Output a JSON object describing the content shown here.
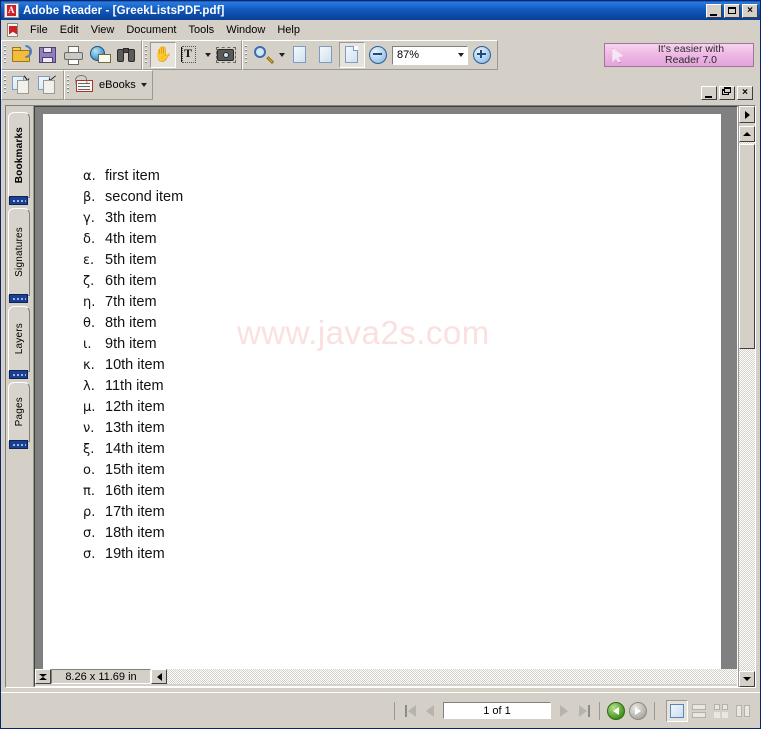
{
  "window": {
    "app_title": "Adobe Reader - [GreekListsPDF.pdf]",
    "app_icon": "adobe-reader-icon",
    "controls": {
      "minimize": "_",
      "maximize": "□",
      "restore": "❐",
      "close": "×"
    }
  },
  "menubar": {
    "doc_icon": "pdf-document-icon",
    "items": [
      {
        "label": "File"
      },
      {
        "label": "Edit"
      },
      {
        "label": "View"
      },
      {
        "label": "Document"
      },
      {
        "label": "Tools"
      },
      {
        "label": "Window"
      },
      {
        "label": "Help"
      }
    ]
  },
  "toolbar": {
    "file_group": [
      {
        "name": "open-button",
        "icon": "open-folder-icon",
        "tooltip": "Open"
      },
      {
        "name": "save-button",
        "icon": "floppy-disk-icon",
        "tooltip": "Save a Copy"
      },
      {
        "name": "print-button",
        "icon": "printer-icon",
        "tooltip": "Print"
      },
      {
        "name": "email-button",
        "icon": "email-globe-icon",
        "tooltip": "Email"
      },
      {
        "name": "search-button",
        "icon": "binoculars-icon",
        "tooltip": "Search"
      }
    ],
    "tools_group": [
      {
        "name": "hand-tool-button",
        "icon": "hand-icon",
        "pressed": true
      },
      {
        "name": "select-text-button",
        "icon": "text-select-icon",
        "pressed": false,
        "has_dropdown": true
      },
      {
        "name": "snapshot-button",
        "icon": "camera-icon",
        "pressed": false
      }
    ],
    "zoom_group": {
      "zoom_tool": {
        "name": "zoom-in-tool-button",
        "icon": "magnifier-plus-icon",
        "has_dropdown": true
      },
      "page_fit_buttons": [
        {
          "name": "actual-size-button",
          "icon": "page-actual-size-icon",
          "pressed": false
        },
        {
          "name": "fit-page-button",
          "icon": "page-fit-page-icon",
          "pressed": false
        },
        {
          "name": "fit-width-button",
          "icon": "page-fit-width-icon",
          "pressed": true
        }
      ],
      "zoom_out": {
        "name": "zoom-out-button",
        "icon": "circle-minus-icon"
      },
      "zoom_value": "87%",
      "zoom_in": {
        "name": "zoom-in-button",
        "icon": "circle-plus-icon"
      }
    },
    "second_row": {
      "history": [
        {
          "name": "previous-view-button",
          "icon": "previous-view-icon"
        },
        {
          "name": "next-view-button",
          "icon": "next-view-icon"
        }
      ],
      "ebooks": {
        "label": "eBooks",
        "icon": "ebooks-icon",
        "has_dropdown": true
      }
    },
    "promo": {
      "icon": "arrow-cursor-icon",
      "line1": "It's easier with",
      "line2": "Reader 7.0"
    }
  },
  "navigation_pane": {
    "tabs": [
      {
        "label": "Bookmarks",
        "active": true
      },
      {
        "label": "Signatures",
        "active": false
      },
      {
        "label": "Layers",
        "active": false
      },
      {
        "label": "Pages",
        "active": false
      }
    ]
  },
  "document": {
    "watermark": "www.java2s.com",
    "list": [
      {
        "marker": "α.",
        "text": "first item"
      },
      {
        "marker": "β.",
        "text": "second item"
      },
      {
        "marker": "γ.",
        "text": "3th item"
      },
      {
        "marker": "δ.",
        "text": "4th item"
      },
      {
        "marker": "ε.",
        "text": "5th item"
      },
      {
        "marker": "ζ.",
        "text": "6th item"
      },
      {
        "marker": "η.",
        "text": "7th item"
      },
      {
        "marker": "θ.",
        "text": "8th item"
      },
      {
        "marker": "ι.",
        "text": "9th item"
      },
      {
        "marker": "κ.",
        "text": "10th item"
      },
      {
        "marker": "λ.",
        "text": "11th item"
      },
      {
        "marker": "μ.",
        "text": "12th item"
      },
      {
        "marker": "ν.",
        "text": "13th item"
      },
      {
        "marker": "ξ.",
        "text": "14th item"
      },
      {
        "marker": "ο.",
        "text": "15th item"
      },
      {
        "marker": "π.",
        "text": "16th item"
      },
      {
        "marker": "ρ.",
        "text": "17th item"
      },
      {
        "marker": "σ.",
        "text": "18th item"
      },
      {
        "marker": "σ.",
        "text": "19th item"
      }
    ],
    "page_size": "8.26 x 11.69 in"
  },
  "statusbar": {
    "first_page_button": "first-page-icon",
    "previous_page_button": "previous-page-icon",
    "page_field": "1 of 1",
    "next_page_button": "next-page-icon",
    "last_page_button": "last-page-icon",
    "back_button": "green-back-arrow-icon",
    "forward_button": "grey-forward-arrow-icon",
    "view_modes": [
      {
        "name": "single-page-view-button",
        "icon": "single-page-icon",
        "active": true
      },
      {
        "name": "continuous-view-button",
        "icon": "continuous-page-icon",
        "active": false
      },
      {
        "name": "continuous-facing-view-button",
        "icon": "continuous-facing-icon",
        "active": false
      },
      {
        "name": "facing-view-button",
        "icon": "facing-page-icon",
        "active": false
      }
    ]
  }
}
